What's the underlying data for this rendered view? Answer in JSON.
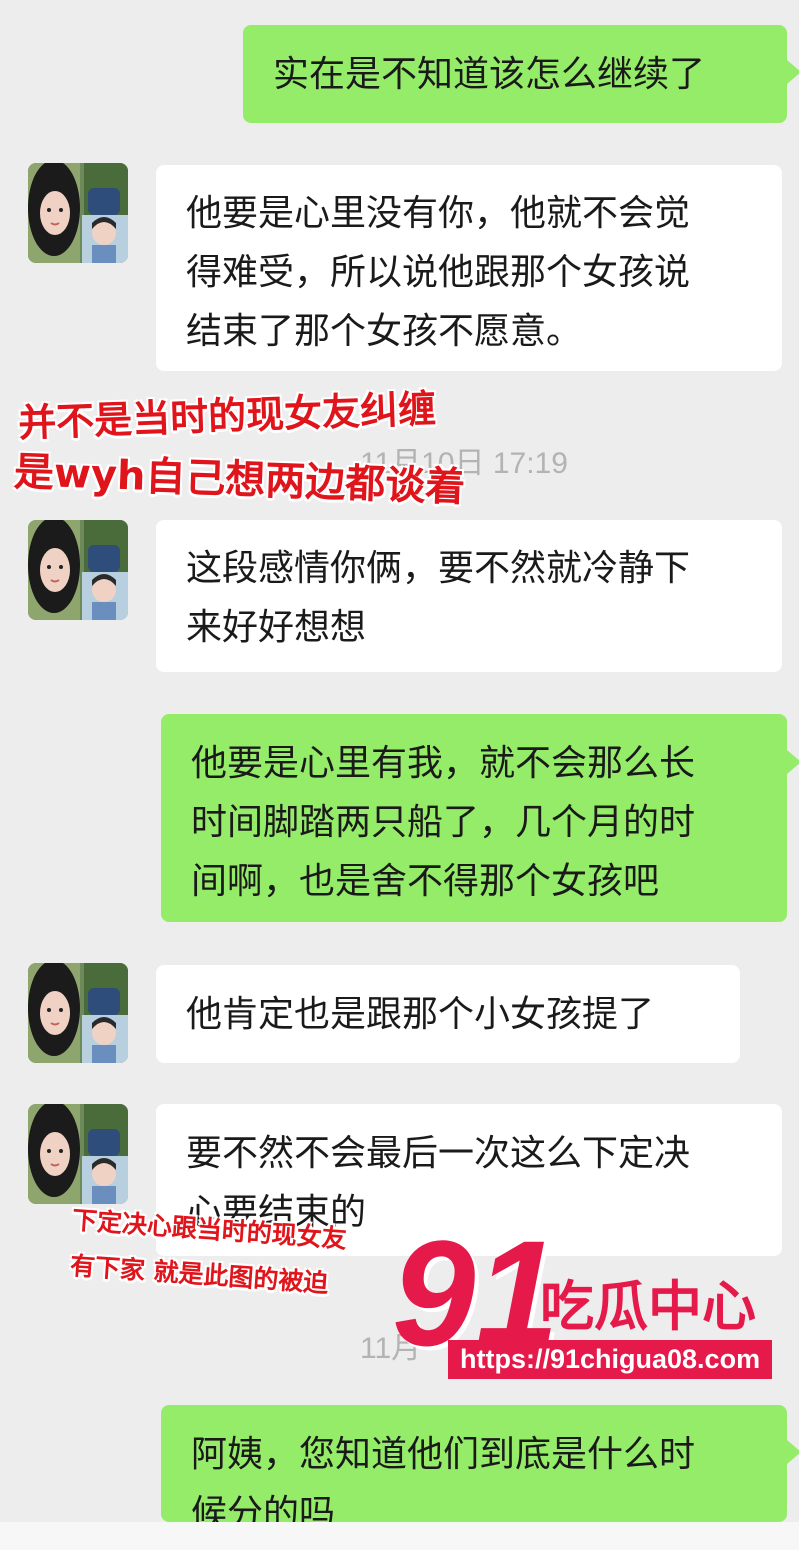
{
  "messages": [
    {
      "side": "out",
      "text": "实在是不知道该怎么继续了"
    },
    {
      "side": "in",
      "text": "他要是心里没有你，他就不会觉\n得难受，所以说他跟那个女孩说\n结束了那个女孩不愿意。"
    },
    {
      "side": "in",
      "text": "这段感情你俩，要不然就冷静下\n来好好想想"
    },
    {
      "side": "out",
      "text": "他要是心里有我，就不会那么长\n时间脚踏两只船了，几个月的时\n间啊，也是舍不得那个女孩吧"
    },
    {
      "side": "in",
      "text": "他肯定也是跟那个小女孩提了"
    },
    {
      "side": "in",
      "text": "要不然不会最后一次这么下定决\n心要结束的"
    },
    {
      "side": "out",
      "text": "阿姨，您知道他们到底是什么时\n候分的吗"
    }
  ],
  "timestamps": [
    "11月10日 17:19",
    "11月"
  ],
  "annotations": [
    "并不是当时的现女友纠缠",
    "是wyh自己想两边都谈着",
    "下定决心跟当时的现女友",
    "有下家 就是此图的被迫"
  ],
  "watermark": {
    "number": "91",
    "name": "吃瓜中心",
    "url": "https://91chigua08.com"
  },
  "colors": {
    "outgoing_bubble": "#95ec69",
    "incoming_bubble": "#ffffff",
    "background": "#ededed",
    "annotation": "#e0141b",
    "watermark": "#e6194b"
  }
}
